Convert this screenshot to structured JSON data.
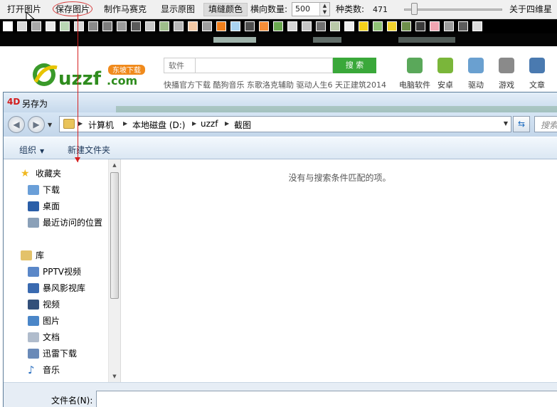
{
  "toolbar": {
    "open_label": "打开图片",
    "save_label": "保存图片",
    "mosaic_label": "制作马赛克",
    "show_original_label": "显示原图",
    "fill_color_label": "填缝颜色",
    "horizontal_count_label": "横向数量:",
    "horizontal_count_value": "500",
    "kinds_label": "种类数:",
    "kinds_value": "471",
    "about_label": "关于四维星"
  },
  "swatches": [
    "#ffffff",
    "#d8d8d8",
    "#a8a8a8",
    "#e8e8e8",
    "#b9d6b4",
    "#dadada",
    "#8a8a8a",
    "#7c7c7c",
    "#9b9b9b",
    "#5a5a5a",
    "#c9c9c9",
    "#9ebd8a",
    "#b7b7b7",
    "#f3c9a6",
    "#9e9e9e",
    "#f07f1c",
    "#a9d3f0",
    "#4f4f4f",
    "#f58d38",
    "#6aa84f",
    "#d8d8d8",
    "#c5c5c5",
    "#707070",
    "#b9c9a8",
    "#eeeeee",
    "#f5d11b",
    "#8fc275",
    "#f2d42e",
    "#6e8f4a",
    "#3a3a3a",
    "#f1a5b1",
    "#9e9e9e",
    "#5c5c5c",
    "#dcdcdc"
  ],
  "site": {
    "logo_text": "uzzf.com",
    "logo_badge": "东坡下载",
    "search_label": "软件",
    "search_button": "搜 索",
    "hot_links": "快播官方下载  酷狗音乐  东歌洛克辅助  驱动人生6  天正建筑2014",
    "nav": [
      {
        "label": "电脑软件",
        "color": "#5aa85a"
      },
      {
        "label": "安卓",
        "color": "#7ab63a"
      },
      {
        "label": "驱动",
        "color": "#6aa0d0"
      },
      {
        "label": "游戏",
        "color": "#8a8a8a"
      },
      {
        "label": "文章",
        "color": "#4a7ab0"
      }
    ]
  },
  "dialog": {
    "title": "另存为",
    "title_icon": "4D",
    "breadcrumbs": [
      "计算机",
      "本地磁盘 (D:)",
      "uzzf",
      "截图"
    ],
    "search_placeholder": "搜索",
    "organize_label": "组织",
    "new_folder_label": "新建文件夹",
    "nav_items": [
      {
        "label": "收藏夹",
        "icon": "star-icon"
      },
      {
        "label": "下载",
        "icon": "download-folder-icon"
      },
      {
        "label": "桌面",
        "icon": "desktop-icon"
      },
      {
        "label": "最近访问的位置",
        "icon": "recent-places-icon"
      },
      {
        "label": "库",
        "icon": "library-icon"
      },
      {
        "label": "PPTV视频",
        "icon": "video-library-icon"
      },
      {
        "label": "暴风影视库",
        "icon": "media-library-icon"
      },
      {
        "label": "视频",
        "icon": "video-icon"
      },
      {
        "label": "图片",
        "icon": "pictures-icon"
      },
      {
        "label": "文档",
        "icon": "documents-icon"
      },
      {
        "label": "迅雷下载",
        "icon": "thunder-download-icon"
      },
      {
        "label": "音乐",
        "icon": "music-icon"
      }
    ],
    "empty_message": "没有与搜索条件匹配的项。",
    "filename_label": "文件名(N):",
    "filename_value": ""
  }
}
